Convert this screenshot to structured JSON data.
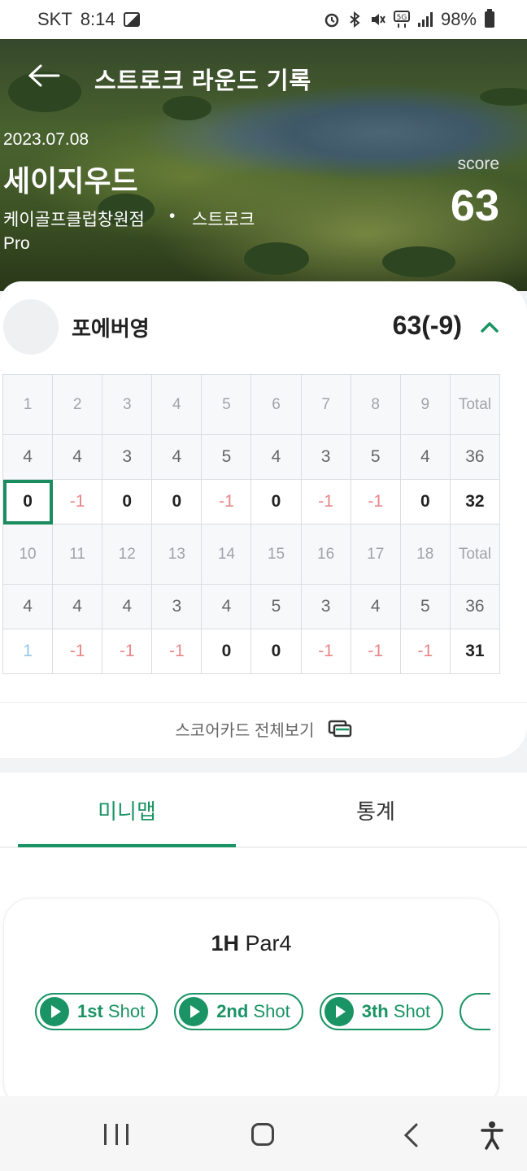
{
  "status_bar": {
    "carrier": "SKT",
    "time": "8:14",
    "battery": "98%",
    "network": "5G"
  },
  "header": {
    "title": "스트로크 라운드 기록",
    "back_icon": "arrow-left-icon"
  },
  "round": {
    "date": "2023.07.08",
    "course": "세이지우드",
    "location": "케이골프클럽창원점",
    "separator": "•",
    "mode": "스트로크",
    "level": "Pro",
    "score_label": "score",
    "score": "63"
  },
  "player": {
    "name": "포에버영",
    "total": "63(-9)"
  },
  "scorecard": {
    "front": {
      "holes": [
        "1",
        "2",
        "3",
        "4",
        "5",
        "6",
        "7",
        "8",
        "9"
      ],
      "total_label": "Total",
      "par": [
        "4",
        "4",
        "3",
        "4",
        "5",
        "4",
        "3",
        "5",
        "4"
      ],
      "par_total": "36",
      "scores": [
        "0",
        "-1",
        "0",
        "0",
        "-1",
        "0",
        "-1",
        "-1",
        "0"
      ],
      "score_total": "32"
    },
    "back": {
      "holes": [
        "10",
        "11",
        "12",
        "13",
        "14",
        "15",
        "16",
        "17",
        "18"
      ],
      "total_label": "Total",
      "par": [
        "4",
        "4",
        "4",
        "3",
        "4",
        "5",
        "3",
        "4",
        "5"
      ],
      "par_total": "36",
      "scores": [
        "1",
        "-1",
        "-1",
        "-1",
        "0",
        "0",
        "-1",
        "-1",
        "-1"
      ],
      "score_total": "31"
    }
  },
  "full_scorecard_label": "스코어카드 전체보기",
  "tabs": [
    {
      "label": "미니맵",
      "active": true
    },
    {
      "label": "통계",
      "active": false
    }
  ],
  "hole_info": {
    "hole": "1H",
    "par": "Par4"
  },
  "shots": [
    {
      "num": "1st",
      "label": "Shot"
    },
    {
      "num": "2nd",
      "label": "Shot"
    },
    {
      "num": "3th",
      "label": "Shot"
    }
  ],
  "colors": {
    "accent": "#1a9464",
    "under_par": "#e98587",
    "over_par": "#92c8e6"
  }
}
